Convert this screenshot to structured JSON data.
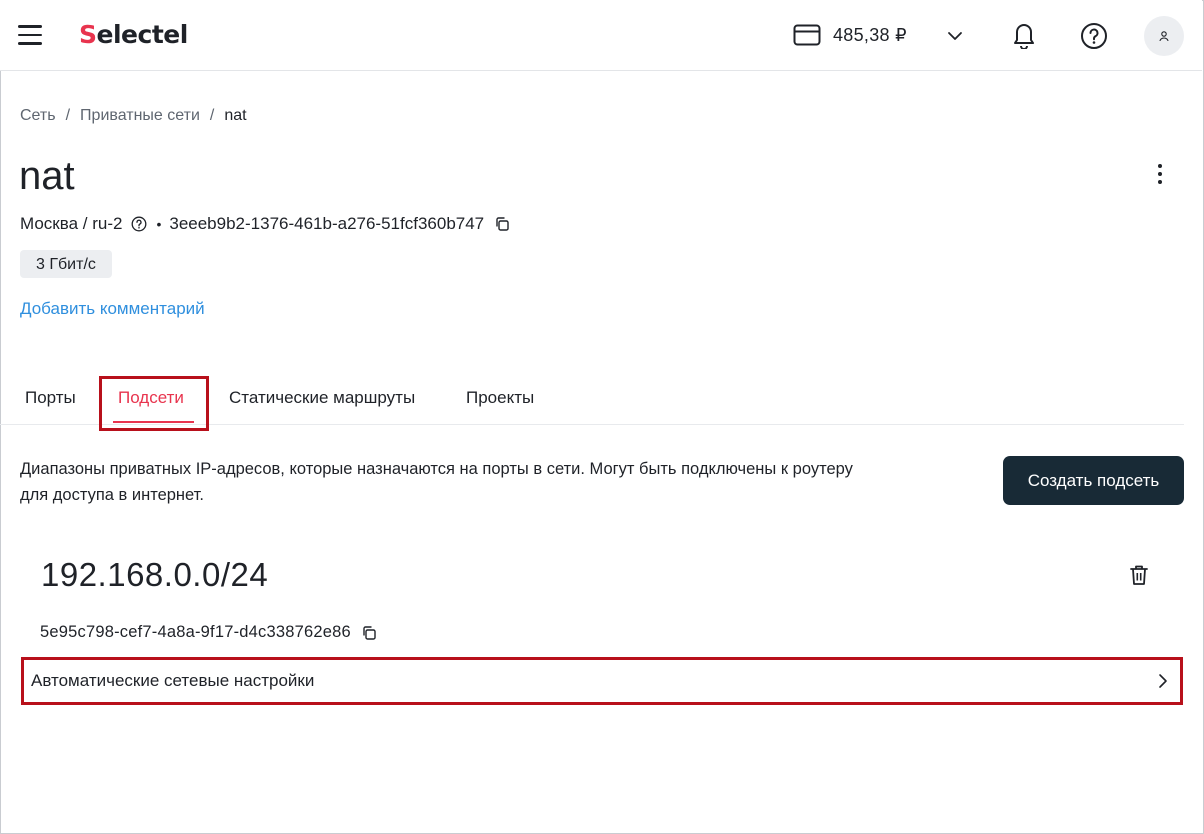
{
  "header": {
    "logo_prefix": "S",
    "logo_rest": "electel",
    "balance": "485,38 ₽",
    "icons": [
      "menu-icon",
      "card-icon",
      "chevron-down-icon",
      "bell-icon",
      "help-icon",
      "user-icon"
    ]
  },
  "breadcrumb": {
    "items": [
      "Сеть",
      "Приватные сети",
      "nat"
    ],
    "separator": "/"
  },
  "network": {
    "title": "nat",
    "location": "Москва / ru-2",
    "id": "3eeeb9b2-1376-461b-a276-51fcf360b747",
    "bullet": "•",
    "bandwidth": "3 Гбит/с",
    "add_comment": "Добавить комментарий"
  },
  "tabs": [
    {
      "label": "Порты",
      "active": false
    },
    {
      "label": "Подсети",
      "active": true
    },
    {
      "label": "Статические маршруты",
      "active": false
    },
    {
      "label": "Проекты",
      "active": false
    }
  ],
  "subnets_section": {
    "description": "Диапазоны приватных IP-адресов, которые назначаются на порты в сети. Могут быть подключены к роутеру для доступа в интернет.",
    "create_button": "Создать подсеть"
  },
  "subnet": {
    "cidr": "192.168.0.0/24",
    "id": "5e95c798-cef7-4a8a-9f17-d4c338762e86",
    "auto_settings_label": "Автоматические сетевые настройки"
  },
  "colors": {
    "accent_red": "#e8344e",
    "link_blue": "#2f8fde",
    "dark_button": "#182a36",
    "highlight_box": "#b8101b"
  }
}
